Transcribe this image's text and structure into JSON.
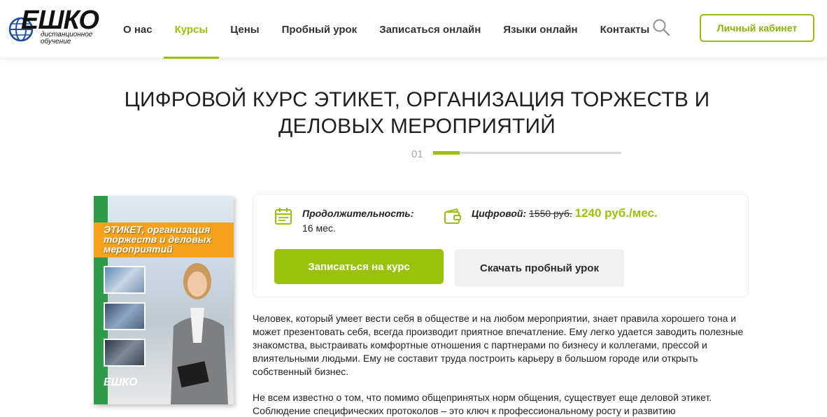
{
  "header": {
    "logo": {
      "wordmark": "ЕШКО",
      "sub1": "дистанционное",
      "sub2": "обучение"
    },
    "nav": [
      {
        "label": "О нас",
        "active": false
      },
      {
        "label": "Курсы",
        "active": true
      },
      {
        "label": "Цены",
        "active": false
      },
      {
        "label": "Пробный урок",
        "active": false
      },
      {
        "label": "Записаться онлайн",
        "active": false
      },
      {
        "label": "Языки онлайн",
        "active": false
      },
      {
        "label": "Контакты",
        "active": false
      }
    ],
    "search_icon": "search-icon",
    "cabinet_label": "Личный кабинет"
  },
  "page": {
    "title": "ЦИФРОВОЙ КУРС ЭТИКЕТ, ОРГАНИЗАЦИЯ ТОРЖЕСТВ И ДЕЛОВЫХ МЕРОПРИЯТИЙ",
    "step": "01",
    "step_progress": 0.14
  },
  "cover": {
    "title": "ЭТИКЕТ, организация торжеств и деловых мероприятий",
    "logo": "ЕШКО"
  },
  "course": {
    "duration_label": "Продолжительность:",
    "duration_value": "16 мес.",
    "price_label": "Цифровой:",
    "price_old": "1550 руб.",
    "price_new": "1240 руб./мес.",
    "enroll_label": "Записаться на курс",
    "trial_label": "Скачать пробный урок"
  },
  "description": [
    "Человек, который умеет вести себя в обществе и на любом мероприятии, знает правила хорошего тона и может презентовать себя, всегда производит приятное впечатление. Ему легко удается заводить полезные знакомства, выстраивать комфортные отношения с партнерами по бизнесу и коллегами, прессой и влиятельными людьми. Ему не составит труда построить карьеру в большом городе или открыть собственный бизнес.",
    "Не всем известно о том, что помимо общепринятых норм общения, существует еще деловой этикет. Соблюдение специфических протоколов – это ключ к профессиональному росту и развитию"
  ],
  "colors": {
    "accent": "#9bbf0e",
    "cover_green": "#2f9a49",
    "cover_orange": "#f4a11c"
  }
}
